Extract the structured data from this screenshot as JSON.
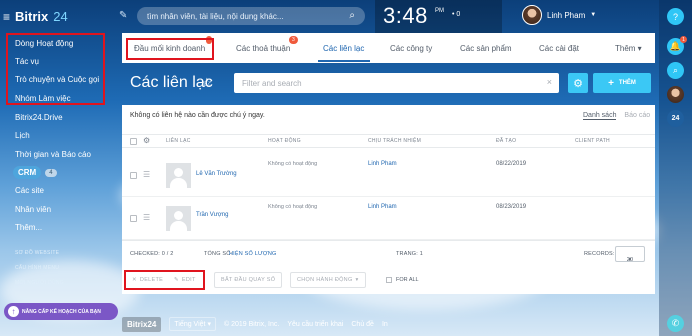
{
  "header": {
    "logo_name": "Bitrix",
    "logo_num": "24",
    "search_placeholder": "tìm nhân viên, tài liệu, nội dung khác...",
    "clock": "3:48",
    "clock_suffix": "PM",
    "clock_count": "0",
    "user_name": "Linh Pham"
  },
  "leftmenu": {
    "items": [
      "Dòng Hoạt động",
      "Tác vụ",
      "Trò chuyện và Cuộc gọi",
      "Nhóm Làm việc",
      "Bitrix24.Drive",
      "Lịch",
      "Thời gian và Báo cáo"
    ],
    "crm_label": "CRM",
    "crm_count": "4",
    "items2": [
      "Các site",
      "Nhân viên",
      "Thêm..."
    ],
    "small": [
      "SƠ ĐỒ WEBSITE",
      "CẤU HÌNH MENU",
      "MỜI NGƯỜI DÙNG"
    ],
    "upgrade": "NÂNG CẤP KẾ HOẠCH CỦA BẠN"
  },
  "tabs": {
    "items": [
      "Đầu mối kinh doanh",
      "Các thoả thuận",
      "Các liên lạc",
      "Các công ty",
      "Các sản phẩm",
      "Các cài đặt",
      "Thêm"
    ],
    "badge_deals": "3",
    "active": "Các liên lạc"
  },
  "page": {
    "title": "Các liên lạc",
    "filter_placeholder": "Filter and search",
    "add_label": "THÊM"
  },
  "grid": {
    "notice": "Không có liên hệ nào cần được chú ý ngay.",
    "view_tabs": [
      "Danh sách",
      "Báo cáo"
    ],
    "columns": [
      "LIÊN LẠC",
      "HOẠT ĐỘNG",
      "CHỊU TRÁCH NHIỆM",
      "ĐÃ TẠO",
      "CLIENT PATH"
    ],
    "rows": [
      {
        "name": "Lê Văn Trường",
        "activity": "Không có hoạt động",
        "responsible": "Linh Pham",
        "created": "08/22/2019"
      },
      {
        "name": "Trần Vượng",
        "activity": "Không có hoạt động",
        "responsible": "Linh Pham",
        "created": "08/23/2019"
      }
    ],
    "checked": "CHECKED: 0 / 2",
    "total_label": "TỔNG SỐ:",
    "total_link": "HIỆN SỐ LƯỢNG",
    "page": "TRANG: 1",
    "records_label": "RECORDS:",
    "records_value": "20"
  },
  "actions": {
    "delete": "DELETE",
    "edit": "EDIT",
    "start_call": "BẮT ĐẦU QUAY SỐ",
    "choose_action": "CHỌN HÀNH ĐỘNG",
    "for_all": "FOR ALL"
  },
  "footer": {
    "bitrix": "Bitrix24",
    "lang": "Tiếng Việt",
    "copyright": "© 2019 Bitrix, Inc.",
    "request": "Yêu cầu triển khai",
    "theme": "Chủ đề",
    "print": "In"
  },
  "rightrail": {
    "badge": "1",
    "counter": "24"
  }
}
